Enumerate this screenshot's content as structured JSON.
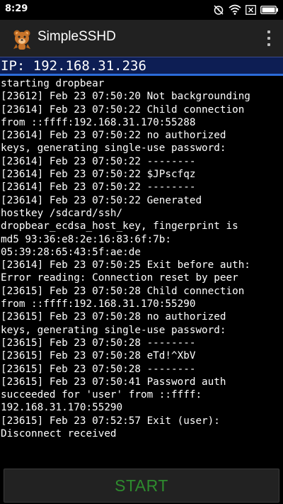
{
  "status_bar": {
    "time": "8:29",
    "icons": [
      "alarm-off-icon",
      "wifi-icon",
      "notification-x-icon",
      "battery-icon"
    ]
  },
  "app_bar": {
    "icon": "bear-app-icon",
    "title": "SimpleSSHD",
    "overflow_icon": "overflow-menu-icon"
  },
  "ip_bar": {
    "text": "IP: 192.168.31.236"
  },
  "log_lines": [
    "starting dropbear",
    "[23612] Feb 23 07:50:20 Not backgrounding",
    "[23614] Feb 23 07:50:22 Child connection",
    "from ::ffff:192.168.31.170:55288",
    "[23614] Feb 23 07:50:22 no authorized",
    "keys, generating single-use password:",
    "[23614] Feb 23 07:50:22 --------",
    "[23614] Feb 23 07:50:22 $JPscfqz",
    "[23614] Feb 23 07:50:22 --------",
    "[23614] Feb 23 07:50:22 Generated",
    "hostkey /sdcard/ssh/",
    "dropbear_ecdsa_host_key, fingerprint is",
    "md5 93:36:e8:2e:16:83:6f:7b:",
    "05:39:28:65:43:5f:ae:de",
    "[23614] Feb 23 07:50:25 Exit before auth:",
    "Error reading: Connection reset by peer",
    "[23615] Feb 23 07:50:28 Child connection",
    "from ::ffff:192.168.31.170:55290",
    "[23615] Feb 23 07:50:28 no authorized",
    "keys, generating single-use password:",
    "[23615] Feb 23 07:50:28 --------",
    "[23615] Feb 23 07:50:28 eTd!^XbV",
    "[23615] Feb 23 07:50:28 --------",
    "[23615] Feb 23 07:50:41 Password auth",
    "succeeded for 'user' from ::ffff:",
    "192.168.31.170:55290",
    "[23615] Feb 23 07:52:57 Exit (user):",
    "Disconnect received"
  ],
  "start_button": {
    "label": "START"
  },
  "colors": {
    "background": "#000000",
    "action_bar": "#212121",
    "ip_bar": "#0d1e54",
    "ip_bar_underline": "#2c6bd9",
    "start_label": "#2e8b2e"
  }
}
